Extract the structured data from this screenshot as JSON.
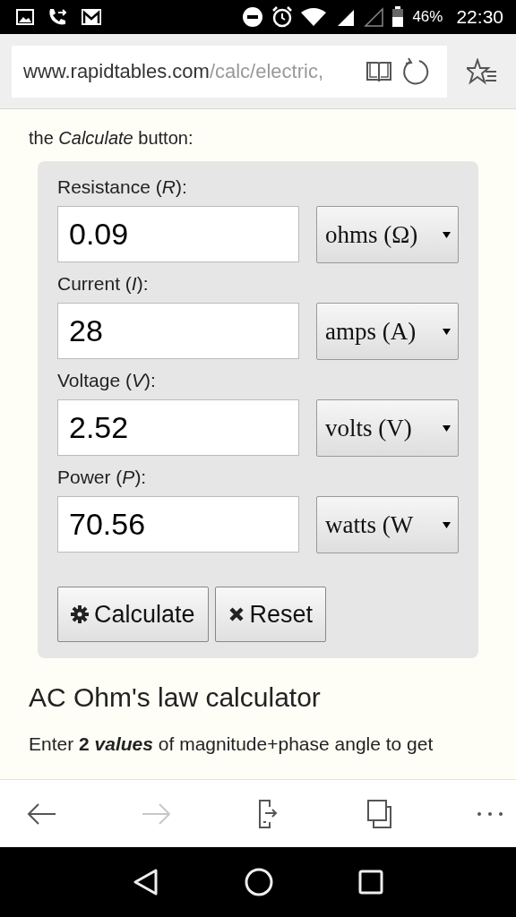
{
  "status_bar": {
    "battery": "46%",
    "time": "22:30"
  },
  "address_bar": {
    "domain": "www.rapidtables.com",
    "path": "/calc/electric,"
  },
  "intro": "the *Calculate* button:",
  "fields": [
    {
      "label": "Resistance (*R*):",
      "value": "0.09",
      "unit": "ohms (Ω)"
    },
    {
      "label": "Current (*I*):",
      "value": "28",
      "unit": "amps (A)"
    },
    {
      "label": "Voltage (*V*):",
      "value": "2.52",
      "unit": "volts (V)"
    },
    {
      "label": "Power (*P*):",
      "value": "70.56",
      "unit": "watts (W"
    }
  ],
  "buttons": [
    {
      "kind": "calculate",
      "label": "Calculate"
    },
    {
      "kind": "reset",
      "label": "Reset"
    }
  ],
  "heading": "AC Ohm's law calculator",
  "paragraph": "Enter **2** *values* of magnitude+phase angle to get",
  "toolbar": [
    {
      "kind": "back",
      "disabled": false
    },
    {
      "kind": "forward",
      "disabled": true
    },
    {
      "kind": "share",
      "disabled": false
    },
    {
      "kind": "tabs",
      "disabled": false
    },
    {
      "kind": "more",
      "disabled": false
    }
  ]
}
